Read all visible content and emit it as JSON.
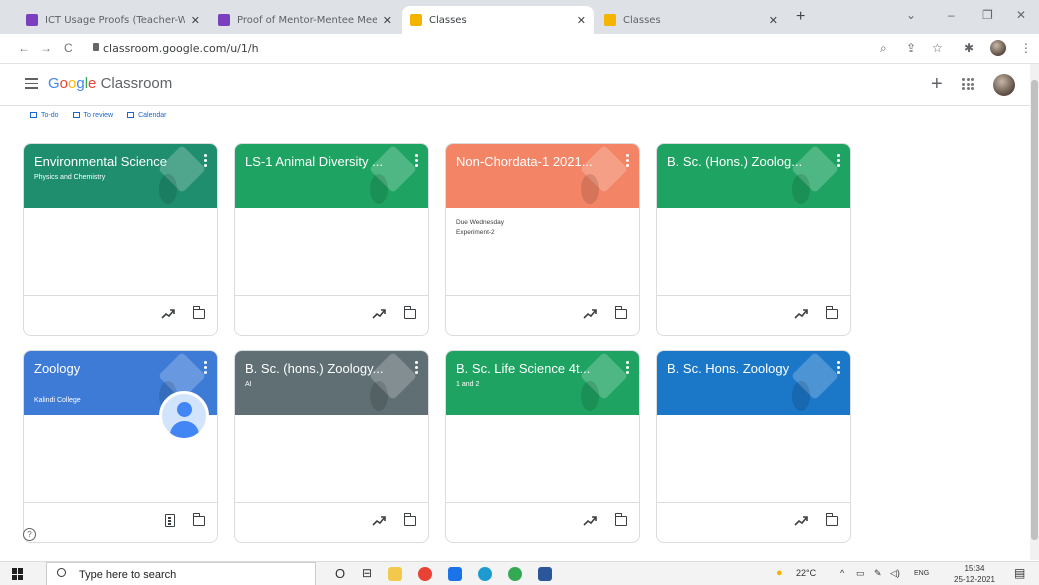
{
  "browser": {
    "tabs": [
      {
        "title": "ICT Usage Proofs (Teacher-Wise)",
        "favicon_color": "#7b3fbf",
        "active": false
      },
      {
        "title": "Proof of Mentor-Mentee Meeting",
        "favicon_color": "#7b3fbf",
        "active": false
      },
      {
        "title": "Classes",
        "favicon_color": "#f4b400",
        "active": true
      },
      {
        "title": "Classes",
        "favicon_color": "#f4b400",
        "active": false
      }
    ],
    "url": "classroom.google.com/u/1/h"
  },
  "app": {
    "logo_google": "Google",
    "logo_product": "Classroom"
  },
  "subnav": [
    {
      "label": "To-do"
    },
    {
      "label": "To review"
    },
    {
      "label": "Calendar"
    }
  ],
  "cards": [
    {
      "title": "Environmental Science",
      "subtitle": "Physics and Chemistry",
      "color": "#1e8e6e",
      "body": [],
      "foot_icon": "trend-icon"
    },
    {
      "title": "LS-1 Animal Diversity ...",
      "subtitle": "",
      "color": "#1ea362",
      "body": [],
      "foot_icon": "trend-icon"
    },
    {
      "title": "Non-Chordata-1 2021...",
      "subtitle": "",
      "color": "#f38466",
      "body": [
        "Due Wednesday",
        "Experiment-2"
      ],
      "foot_icon": "trend-icon"
    },
    {
      "title": "B. Sc. (Hons.) Zoolog...",
      "subtitle": "",
      "color": "#1ea362",
      "body": [],
      "foot_icon": "trend-icon"
    },
    {
      "title": "Zoology",
      "subtitle": "Kalindi College",
      "color": "#3e7bd6",
      "body": [],
      "foot_icon": "assignment-icon"
    },
    {
      "title": "B. Sc. (hons.) Zoology...",
      "subtitle": "AI",
      "color": "#5f6f74",
      "body": [],
      "foot_icon": "trend-icon"
    },
    {
      "title": "B. Sc. Life Science 4t...",
      "subtitle": "1 and 2",
      "color": "#1ea362",
      "body": [],
      "foot_icon": "trend-icon"
    },
    {
      "title": "B. Sc. Hons. Zoology",
      "subtitle": "",
      "color": "#1b77c8",
      "body": [],
      "foot_icon": "trend-icon"
    }
  ],
  "taskbar": {
    "search_placeholder": "Type here to search",
    "weather": "22°C",
    "lang": "ENG",
    "time": "15:34",
    "date": "25-12-2021"
  }
}
